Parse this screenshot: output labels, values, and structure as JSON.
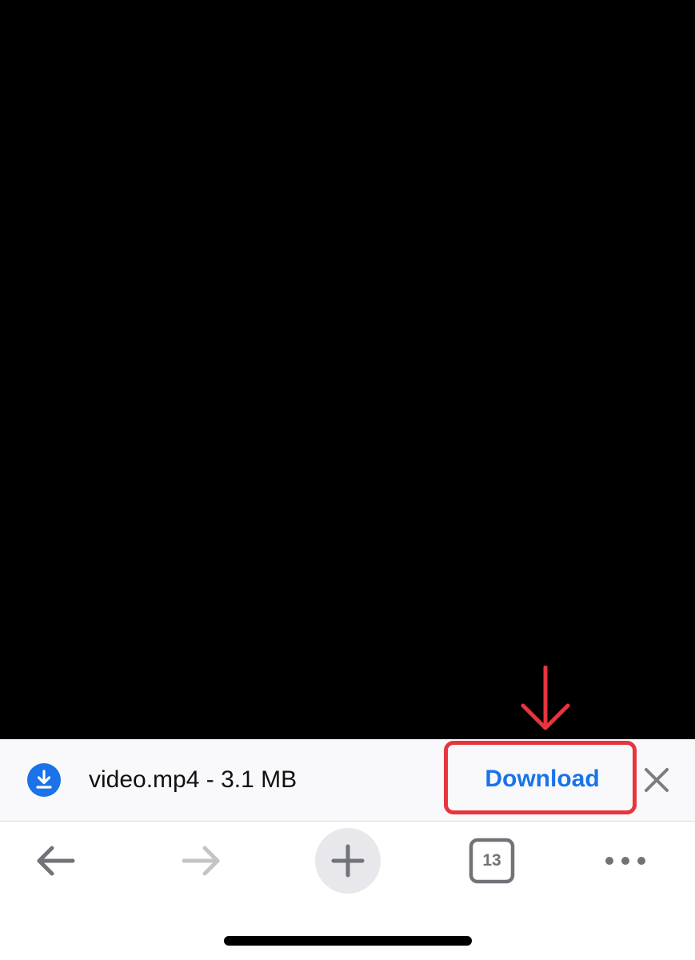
{
  "download_bar": {
    "filename": "video.mp4 - 3.1 MB",
    "download_label": "Download",
    "icon": "download-circle-icon",
    "close_icon": "close-icon"
  },
  "toolbar": {
    "back_icon": "back-arrow-icon",
    "forward_icon": "forward-arrow-icon",
    "new_tab_icon": "plus-icon",
    "tab_count": "13",
    "more_icon": "more-horizontal-icon"
  },
  "annotation": {
    "color": "#e8353d"
  },
  "colors": {
    "accent": "#1a73e8",
    "annotation": "#e8353d"
  }
}
